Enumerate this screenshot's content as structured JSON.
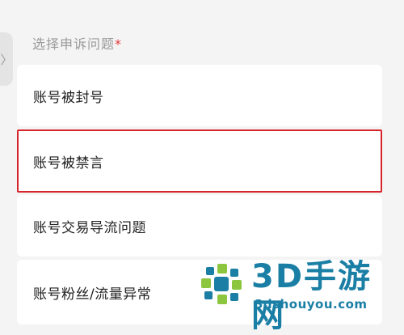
{
  "side_handle": {
    "icon": "chevron-right-icon",
    "glyph": "〉"
  },
  "section": {
    "title": "选择申诉问题",
    "required_mark": "*"
  },
  "options": [
    {
      "label": "账号被封号",
      "selected": false
    },
    {
      "label": "账号被禁言",
      "selected": true
    },
    {
      "label": "账号交易导流问题",
      "selected": false
    },
    {
      "label": "账号粉丝/流量异常",
      "selected": false
    }
  ],
  "watermark": {
    "brand": "3D手游网",
    "url": "3dshouyou.com"
  },
  "colors": {
    "selected_border": "#d6262b",
    "required": "#e8383d",
    "watermark": "#1b7fa5"
  }
}
